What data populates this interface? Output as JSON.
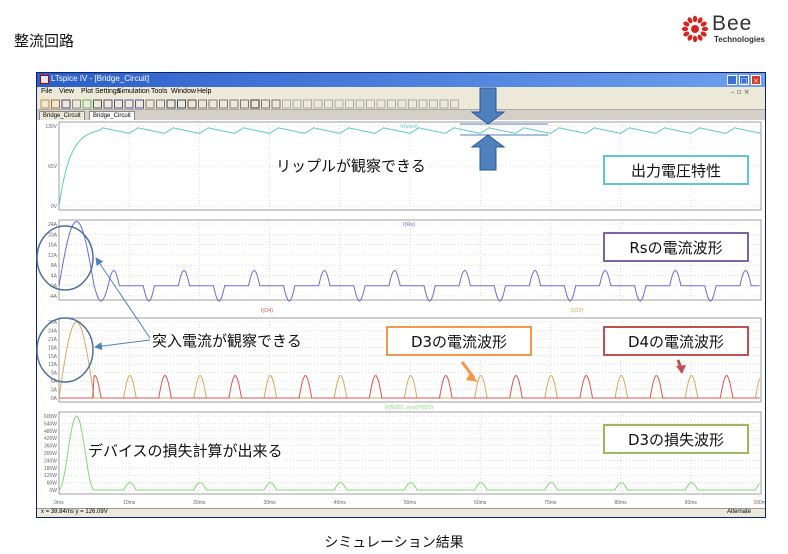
{
  "slide": {
    "title": "整流回路",
    "caption": "シミュレーション結果",
    "logo": {
      "name": "Bee",
      "sub": "Technologies",
      "color": "#d8231f"
    }
  },
  "window": {
    "title": "LTspice IV - [Bridge_Circuit]",
    "menu": [
      "File",
      "View",
      "Plot Settings",
      "Simulation",
      "Tools",
      "Window",
      "Help"
    ],
    "tabs": [
      {
        "label": "Bridge_Circuit",
        "active": false
      },
      {
        "label": "Bridge_Circuit",
        "active": true
      }
    ],
    "status": {
      "cursor": "x = 39.84ms    y = 126.09V",
      "mode": "Alternate"
    }
  },
  "panes": [
    {
      "trace_label": "V(vout)",
      "y_ticks": [
        "130V",
        "65V",
        "0V"
      ],
      "trace_color": "#5fc6c6"
    },
    {
      "trace_label": "I(Rs)",
      "y_ticks": [
        "24A",
        "20A",
        "16A",
        "12A",
        "8A",
        "4A",
        "0A",
        "-4A"
      ],
      "trace_color": "#6a6ad8"
    },
    {
      "trace_label_a": "I(D4)",
      "trace_label_b": "I(D3)",
      "y_ticks": [
        "27A",
        "24A",
        "21A",
        "18A",
        "15A",
        "12A",
        "9A",
        "6A",
        "3A",
        "0A"
      ],
      "trace_color_a": "#e05050",
      "trace_color_b": "#d8a85a"
    },
    {
      "trace_label": "V(N002, vout)*I(D3)",
      "y_ticks": [
        "600W",
        "540W",
        "480W",
        "420W",
        "360W",
        "300W",
        "240W",
        "180W",
        "120W",
        "60W",
        "0W"
      ],
      "trace_color": "#7fd870"
    }
  ],
  "x_ticks": [
    "0ms",
    "10ms",
    "20ms",
    "30ms",
    "40ms",
    "50ms",
    "60ms",
    "70ms",
    "80ms",
    "90ms",
    "100ms"
  ],
  "callouts": {
    "output_voltage": {
      "label": "出力電圧特性",
      "color": "#5fc6d8"
    },
    "rs_current": {
      "label": "Rsの電流波形",
      "color": "#8064a2"
    },
    "d3_current": {
      "label": "D3の電流波形",
      "color": "#f79646"
    },
    "d4_current": {
      "label": "D4の電流波形",
      "color": "#c0504d"
    },
    "d3_loss": {
      "label": "D3の損失波形",
      "color": "#9bbb59"
    }
  },
  "annotations": {
    "ripple": "リップルが観察できる",
    "inrush": "突入電流が観察できる",
    "loss_calc": "デバイスの損失計算が出来る"
  },
  "annotation_colors": {
    "ring": "#4f6f9f",
    "arrow": "#4f81bd"
  }
}
